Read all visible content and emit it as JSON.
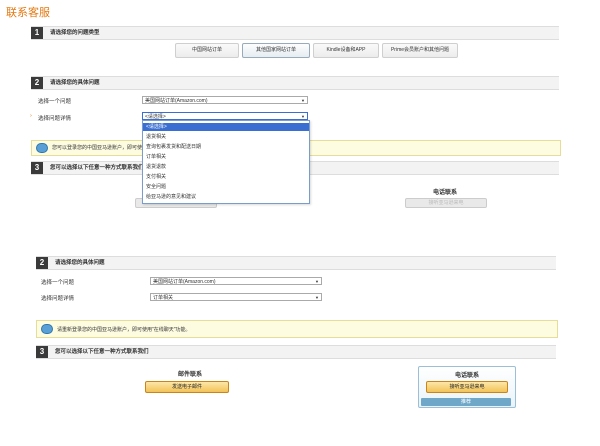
{
  "page_title": "联系客服",
  "step1": {
    "num": "1",
    "label": "请选择您的问题类型",
    "options": [
      "中国网站订单",
      "其他国家网站订单",
      "Kindle设备和APP",
      "Prime会员账户和其他问题"
    ]
  },
  "step2_top": {
    "num": "2",
    "label": "请选择您的具体问题",
    "q1_label": "选择一个问题",
    "q1_value": "美国网站订单(Amazon.com)",
    "q2_label": "选择问题详情",
    "q2_value": "<请选择>",
    "dropdown_options": [
      "<请选择>",
      "退货相关",
      "查询包裹发货和配送日期",
      "订单相关",
      "退货退款",
      "支付相关",
      "安全问题",
      "给亚马逊的意见和建议"
    ],
    "dropdown_highlight_index": 0
  },
  "notice_top": {
    "text": "您可以登录您的中国亚马逊账户，即可使用"
  },
  "step3_top": {
    "num": "3",
    "label": "您可以选择以下任意一种方式联系我们",
    "phone_heading": "电话联系",
    "phone_button": "接听亚马逊来电"
  },
  "step2_bottom": {
    "num": "2",
    "label": "请选择您的具体问题",
    "q1_label": "选择一个问题",
    "q1_value": "美国网站订单(Amazon.com)",
    "q2_label": "选择问题详情",
    "q2_value": "订单相关"
  },
  "notice_bottom": {
    "text": "请重新登录您的中国亚马逊账户，即可使用\"在线聊天\"功能。"
  },
  "step3_bottom": {
    "num": "3",
    "label": "您可以选择以下任意一种方式联系我们",
    "email_heading": "邮件联系",
    "email_button": "发送电子邮件",
    "phone_heading": "电话联系",
    "phone_button": "接听亚马逊来电",
    "phone_sub": "推荐"
  }
}
